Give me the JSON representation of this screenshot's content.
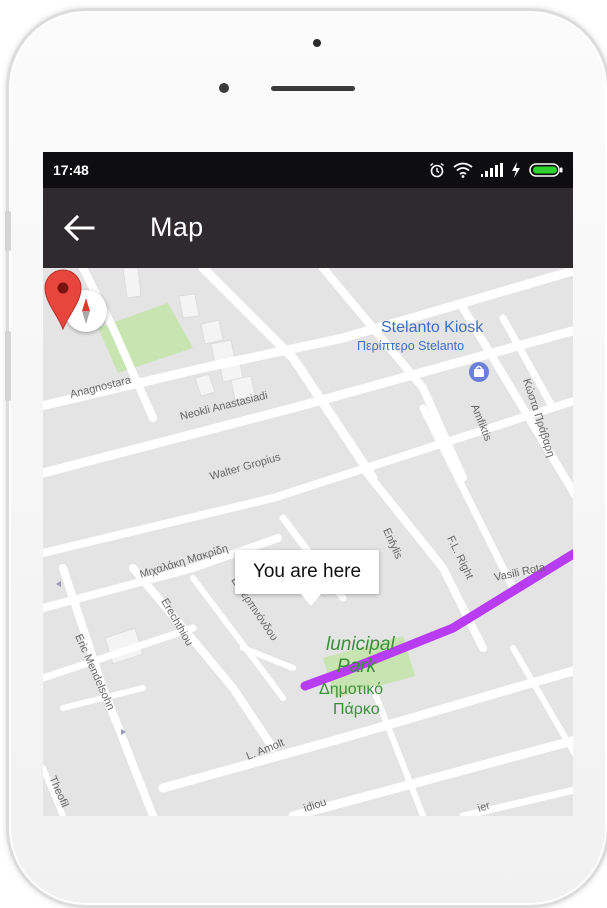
{
  "status_bar": {
    "time": "17:48",
    "icons": [
      "alarm-icon",
      "wifi-icon",
      "signal-icon",
      "charging-icon",
      "battery-icon"
    ],
    "battery_color": "#2fd12f"
  },
  "app_bar": {
    "title": "Map",
    "back_icon": "arrow-left-icon",
    "background": "#2e2a2e"
  },
  "map": {
    "marker_label": "You are here",
    "route_color": "#b73cf4",
    "pois": [
      {
        "name": "Stelanto Kiosk",
        "subname": "Περίπτερο Stelanto",
        "icon": "shopping-bag-icon"
      },
      {
        "name": "Municipal Park",
        "subname_line1": "Δημοτικό",
        "subname_line2": "Πάρκο"
      }
    ],
    "park_label_line1": "lunicipal",
    "park_label_line2": "Park",
    "streets": {
      "anagnostara": "Anagnostara",
      "neokli": "Neokli Anastasiadi",
      "walter": "Walter Gropius",
      "michalakis": "Μιχαλάκη Μακρίδη",
      "erechthiou": "Erechthiou",
      "eric": "Eric Mendelsohn",
      "theofil": "Theofil",
      "efterpi": "Ευτερπινόνδου",
      "amfiktis": "Amfiktis",
      "enfylis": "Enfylis",
      "flright": "F.L. Right",
      "vasili": "Vasili Rota",
      "kosta": "Κώστα Πράβαρη",
      "lamolt": "L. Amolt",
      "bottom1": "idiou",
      "bottom2": "ier"
    }
  }
}
